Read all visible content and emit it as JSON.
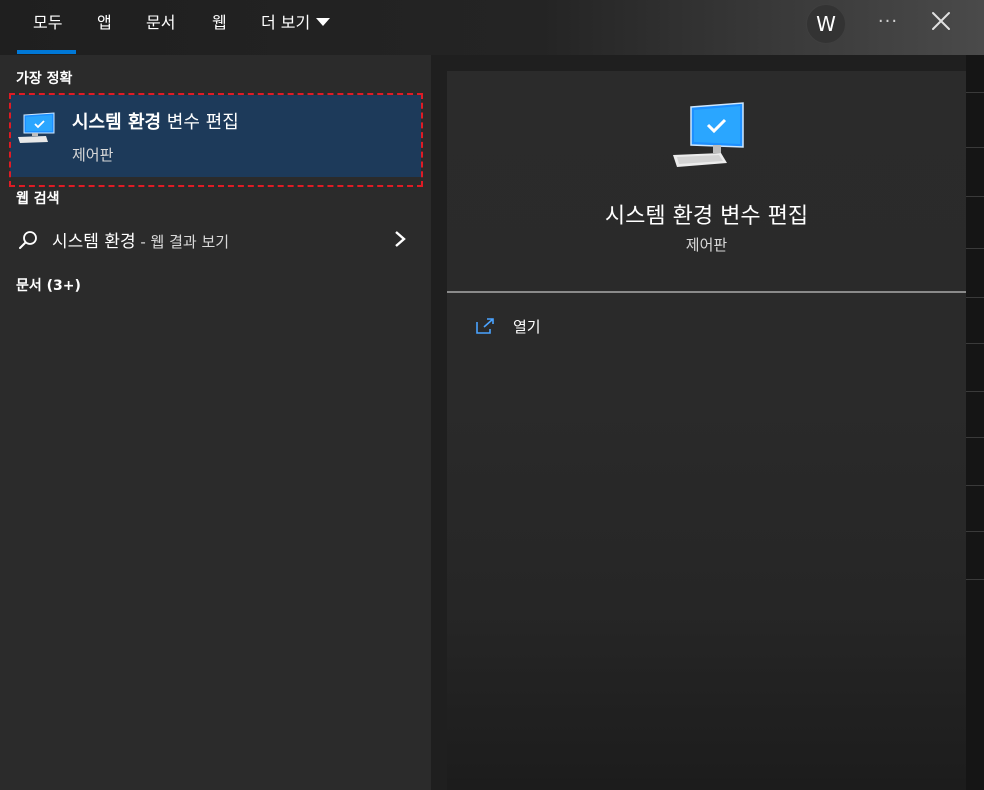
{
  "tabs": [
    {
      "label": "모두",
      "active": true
    },
    {
      "label": "앱"
    },
    {
      "label": "문서"
    },
    {
      "label": "웹"
    },
    {
      "label": "더 보기"
    }
  ],
  "avatar": {
    "initial": "W"
  },
  "more_options": "···",
  "left": {
    "best_match_header": "가장 정확",
    "best_match": {
      "title_bold": "시스템 환경",
      "title_rest": " 변수 편집",
      "subtitle": "제어판",
      "icon": "computer-monitor-icon"
    },
    "web_search_header": "웹 검색",
    "web_search": {
      "query": "시스템 환경",
      "suffix": " - 웹 결과 보기",
      "icon": "search-icon"
    },
    "documents_header": "문서 (3+)"
  },
  "detail": {
    "title": "시스템 환경 변수 편집",
    "subtitle": "제어판",
    "icon": "computer-monitor-icon",
    "actions": [
      {
        "label": "열기",
        "icon": "open-external-icon"
      }
    ]
  },
  "colors": {
    "accent": "#0078d7",
    "selection": "#1d3a5a",
    "focus_ring": "#e01b24"
  }
}
